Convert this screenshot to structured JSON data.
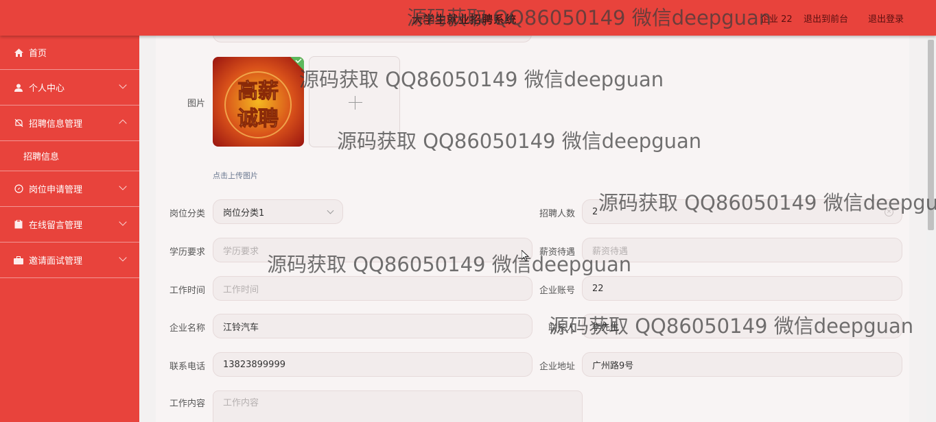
{
  "header": {
    "title": "大学生就业招聘系统",
    "user": "企业 22",
    "front_link": "退出到前台",
    "logout_link": "退出登录"
  },
  "sidebar": {
    "items": [
      {
        "label": "首页",
        "icon": "home-icon"
      },
      {
        "label": "个人中心",
        "icon": "user-icon"
      },
      {
        "label": "招聘信息管理",
        "icon": "bell-icon",
        "expanded": true
      },
      {
        "label": "岗位申请管理",
        "icon": "compass-icon"
      },
      {
        "label": "在线留言管理",
        "icon": "clipboard-icon"
      },
      {
        "label": "邀请面试管理",
        "icon": "briefcase-icon"
      }
    ],
    "sub_items": [
      {
        "label": "招聘信息"
      }
    ]
  },
  "form": {
    "image_label": "图片",
    "upload_tip": "点击上传图片",
    "image_text": "高薪诚聘",
    "category_label": "岗位分类",
    "category_value": "岗位分类1",
    "headcount_label": "招聘人数",
    "headcount_value": "2",
    "education_label": "学历要求",
    "education_placeholder": "学历要求",
    "salary_label": "薪资待遇",
    "salary_placeholder": "薪资待遇",
    "worktime_label": "工作时间",
    "worktime_placeholder": "工作时间",
    "account_label": "企业账号",
    "account_value": "22",
    "company_label": "企业名称",
    "company_value": "江铃汽车",
    "contact_label": "联系人",
    "contact_value": "李先生",
    "phone_label": "联系电话",
    "phone_value": "13823899999",
    "address_label": "企业地址",
    "address_value": "广州路9号",
    "content_label": "工作内容",
    "content_placeholder": "工作内容"
  },
  "watermark": "源码获取 QQ86050149 微信deepguan",
  "colors": {
    "primary": "#e8433c",
    "accent_check": "#5cb85c"
  }
}
